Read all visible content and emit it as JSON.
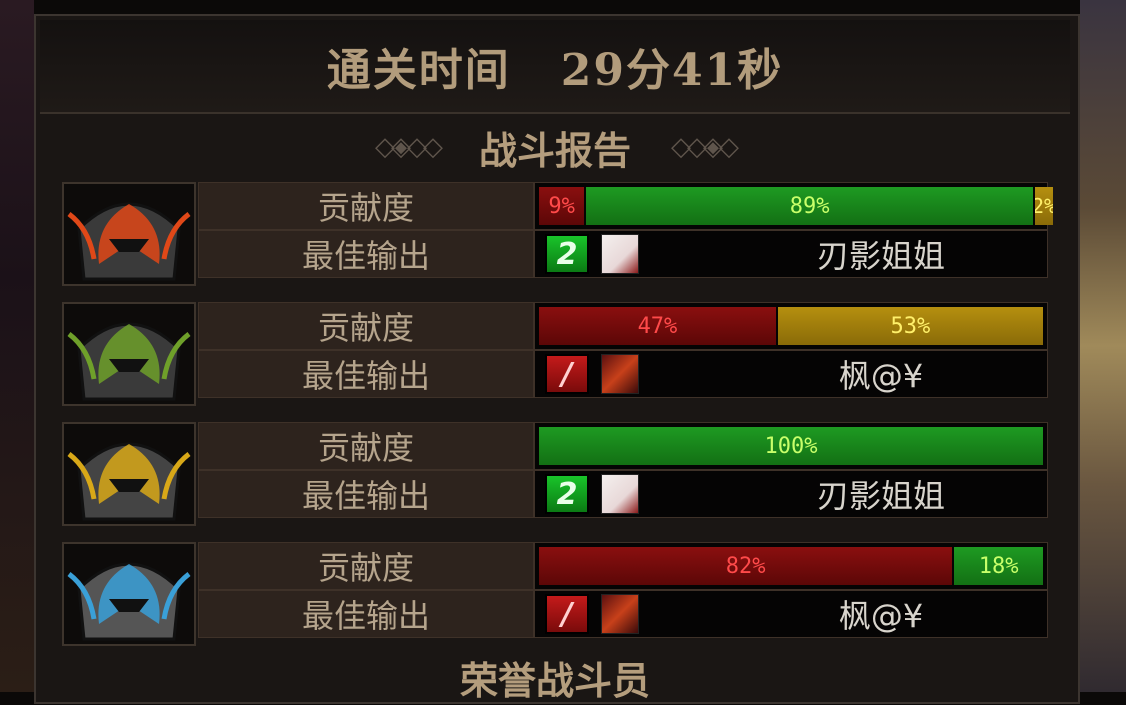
{
  "header": {
    "label": "通关时间",
    "time": "29分41秒"
  },
  "section": {
    "title": "战斗报告"
  },
  "labels": {
    "contribution": "贡献度",
    "best_output": "最佳输出"
  },
  "players": [
    {
      "portrait_icon": "flame-helmet-icon",
      "portrait_colors": [
        "#e04818",
        "#3a3a3a"
      ],
      "contribution": [
        {
          "label": "9%",
          "value": 9,
          "color": "red"
        },
        {
          "label": "89%",
          "value": 89,
          "color": "green"
        },
        {
          "label": "2%",
          "value": 2,
          "color": "gold"
        }
      ],
      "best": {
        "rank": "2",
        "rank_color": "green",
        "avatar_icon": "white-avatar-icon",
        "name": "刃影姐姐"
      }
    },
    {
      "portrait_icon": "green-horned-helmet-icon",
      "portrait_colors": [
        "#6fa02a",
        "#3a3a3a"
      ],
      "contribution": [
        {
          "label": "47%",
          "value": 47,
          "color": "red"
        },
        {
          "label": "53%",
          "value": 53,
          "color": "gold"
        }
      ],
      "best": {
        "rank": "/",
        "rank_color": "red",
        "avatar_icon": "red-armor-avatar-icon",
        "name": "枫@¥"
      }
    },
    {
      "portrait_icon": "gold-dark-helmet-icon",
      "portrait_colors": [
        "#d8a818",
        "#444444"
      ],
      "contribution": [
        {
          "label": "100%",
          "value": 100,
          "color": "green"
        }
      ],
      "best": {
        "rank": "2",
        "rank_color": "green",
        "avatar_icon": "white-avatar-icon",
        "name": "刃影姐姐"
      }
    },
    {
      "portrait_icon": "blue-spiked-helmet-icon",
      "portrait_colors": [
        "#3aa0d8",
        "#555555"
      ],
      "contribution": [
        {
          "label": "82%",
          "value": 82,
          "color": "red"
        },
        {
          "label": "18%",
          "value": 18,
          "color": "green"
        }
      ],
      "best": {
        "rank": "/",
        "rank_color": "red",
        "avatar_icon": "red-armor-avatar-icon",
        "name": "枫@¥"
      }
    }
  ],
  "footer": {
    "title": "荣誉战斗员"
  }
}
